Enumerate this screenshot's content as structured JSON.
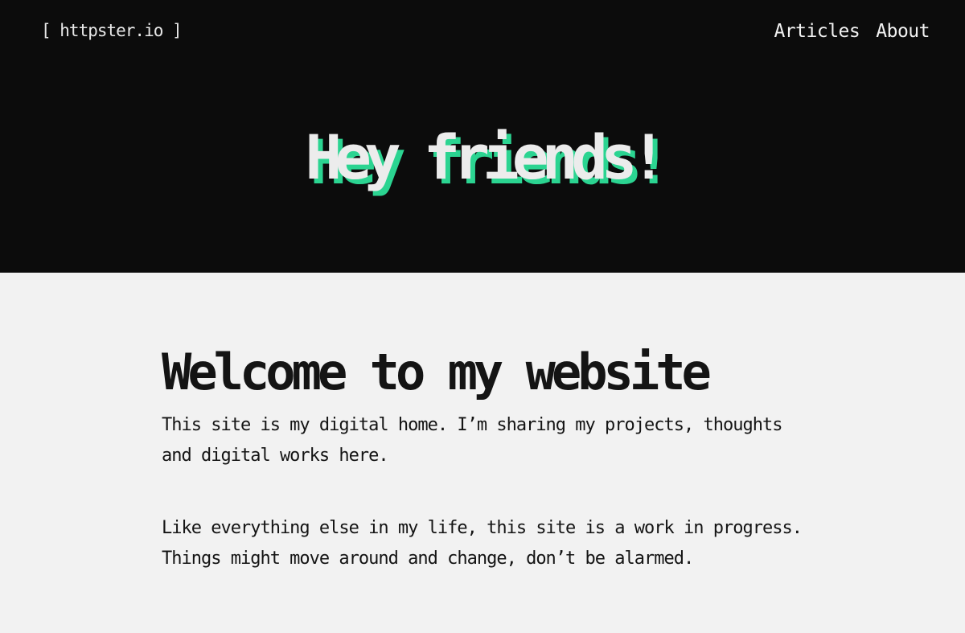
{
  "header": {
    "logo": "[ httpster.io ]",
    "nav": [
      {
        "label": "Articles"
      },
      {
        "label": "About"
      }
    ]
  },
  "hero": {
    "title": "Hey friends!"
  },
  "main": {
    "heading": "Welcome to my website",
    "paragraphs": [
      "This site is my digital home. I’m sharing my projects, thoughts and digital works here.",
      "Like everything else in my life, this site is a work in progress. Things might move around and change, don’t be alarmed."
    ]
  },
  "colors": {
    "hero_background": "#0c0c0c",
    "page_background": "#f2f2f2",
    "accent": "#2bd491",
    "text_dark": "#141414",
    "text_light": "#ececec"
  }
}
